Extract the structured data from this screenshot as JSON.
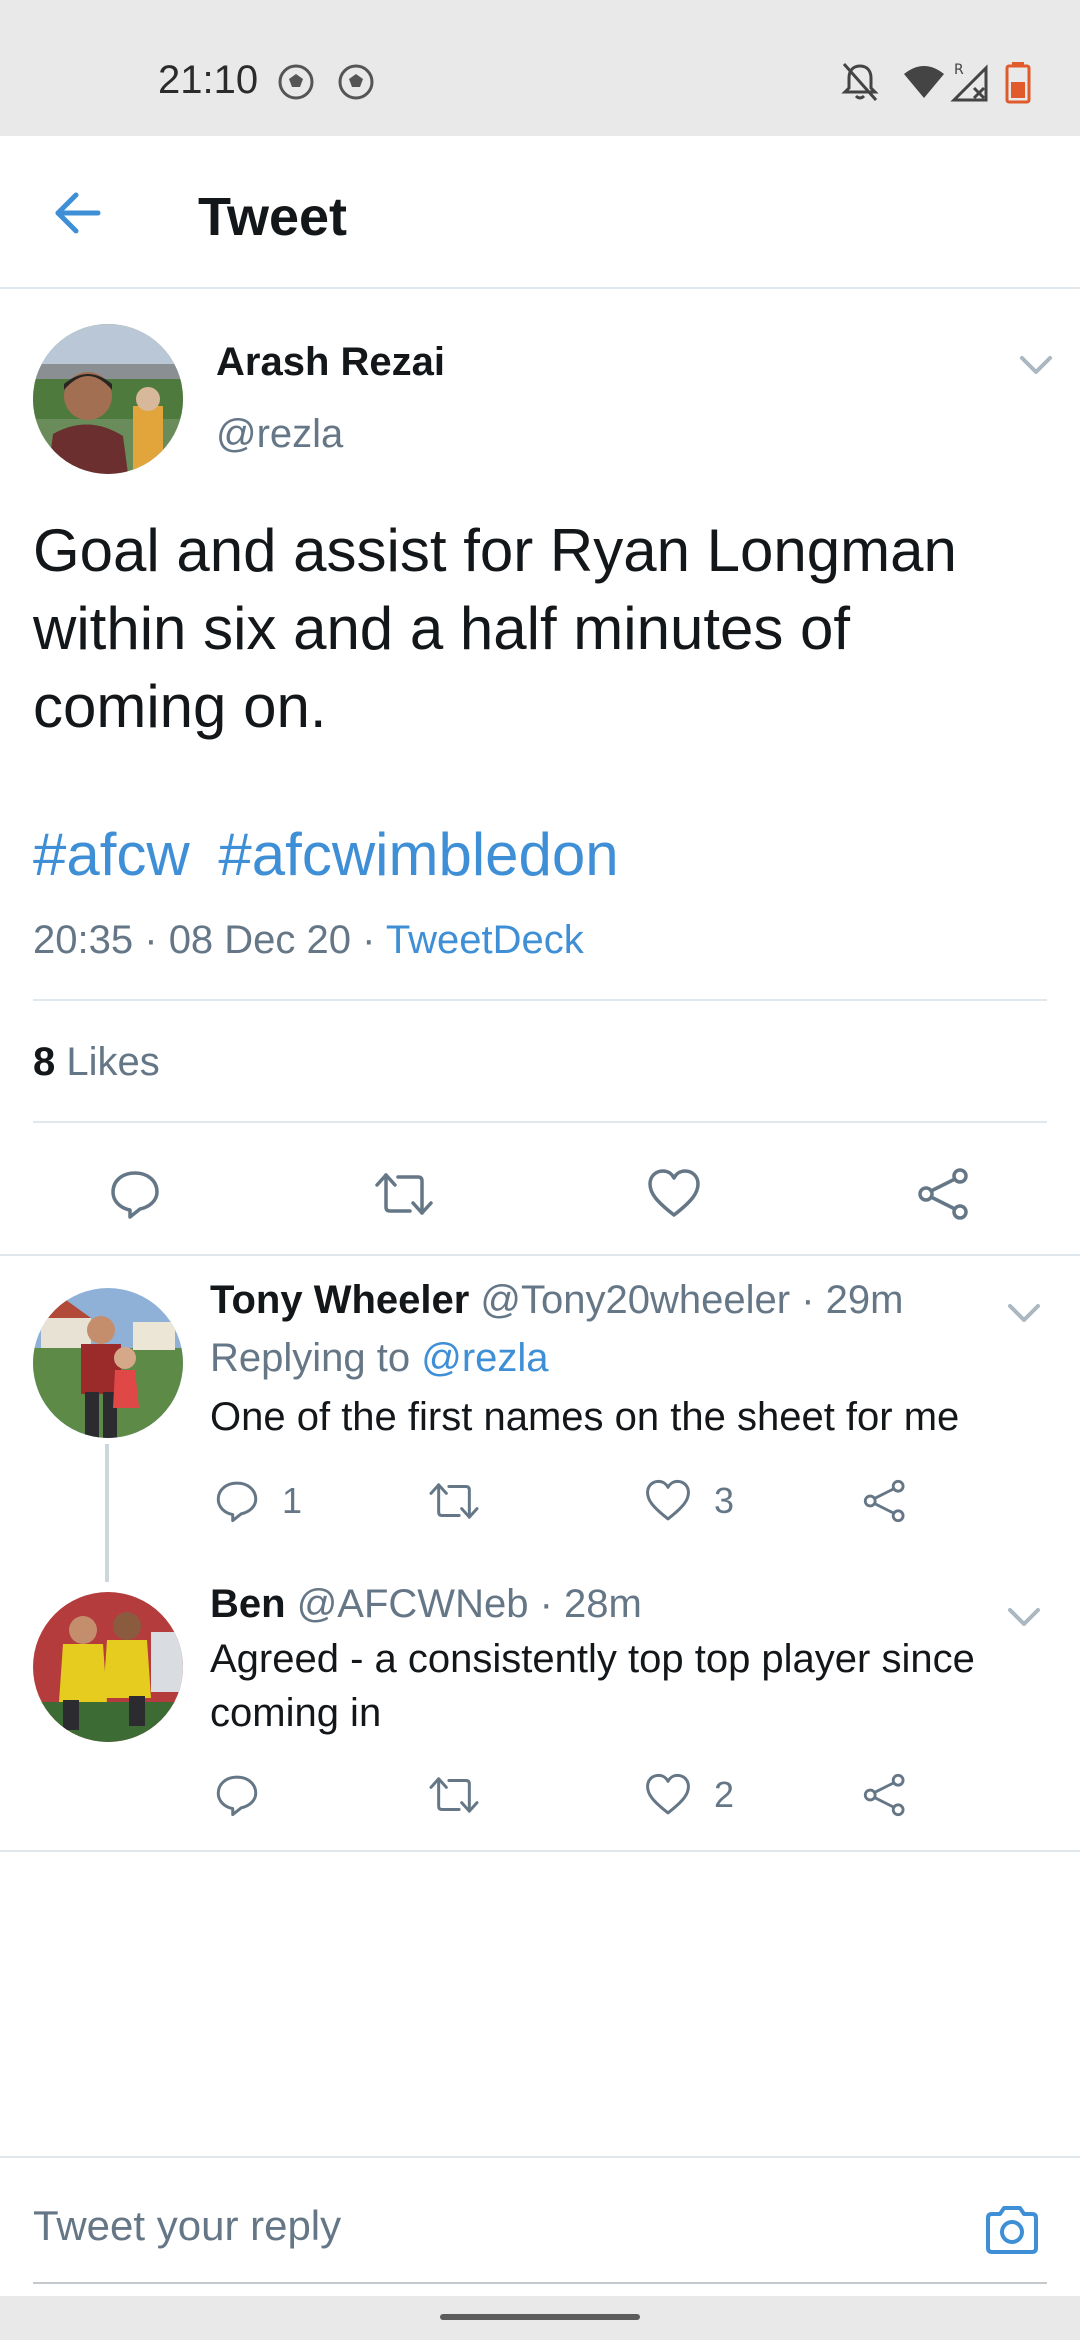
{
  "status_bar": {
    "time": "21:10",
    "icons": [
      "soccer-ball-icon",
      "soccer-ball-icon",
      "bell-off-icon",
      "wifi-icon",
      "signal-roaming-icon",
      "battery-low-icon"
    ]
  },
  "app_bar": {
    "title": "Tweet",
    "back_icon": "arrow-left-icon"
  },
  "tweet": {
    "author_name": "Arash Rezai",
    "author_handle": "@rezla",
    "text": "Goal and assist for Ryan Longman within six and a half minutes of coming on.",
    "hashtags": [
      "#afcw",
      "#afcwimbledon"
    ],
    "time": "20:35",
    "date": "08 Dec 20",
    "separator": "·",
    "source": "TweetDeck",
    "likes_count": "8",
    "likes_label": "Likes",
    "actions": [
      "reply-icon",
      "retweet-icon",
      "like-icon",
      "share-icon"
    ]
  },
  "replies": [
    {
      "name": "Tony Wheeler",
      "handle": "@Tony20wheeler",
      "time": "29m",
      "replying_to_label": "Replying to",
      "replying_to_handle": "@rezla",
      "text": "One of the first names on the sheet for me",
      "reply_count": "1",
      "retweet_count": "",
      "like_count": "3"
    },
    {
      "name": "Ben",
      "handle": "@AFCWNeb",
      "time": "28m",
      "text": "Agreed - a consistently top top player since coming in",
      "reply_count": "",
      "retweet_count": "",
      "like_count": "2"
    }
  ],
  "composer": {
    "placeholder": "Tweet your reply",
    "camera_icon": "camera-icon"
  },
  "colors": {
    "accent": "#3f8fd6",
    "secondary_text": "#657786",
    "primary_text": "#14171a",
    "divider": "#e1e8ed",
    "system_bar": "#e9e9ea"
  }
}
